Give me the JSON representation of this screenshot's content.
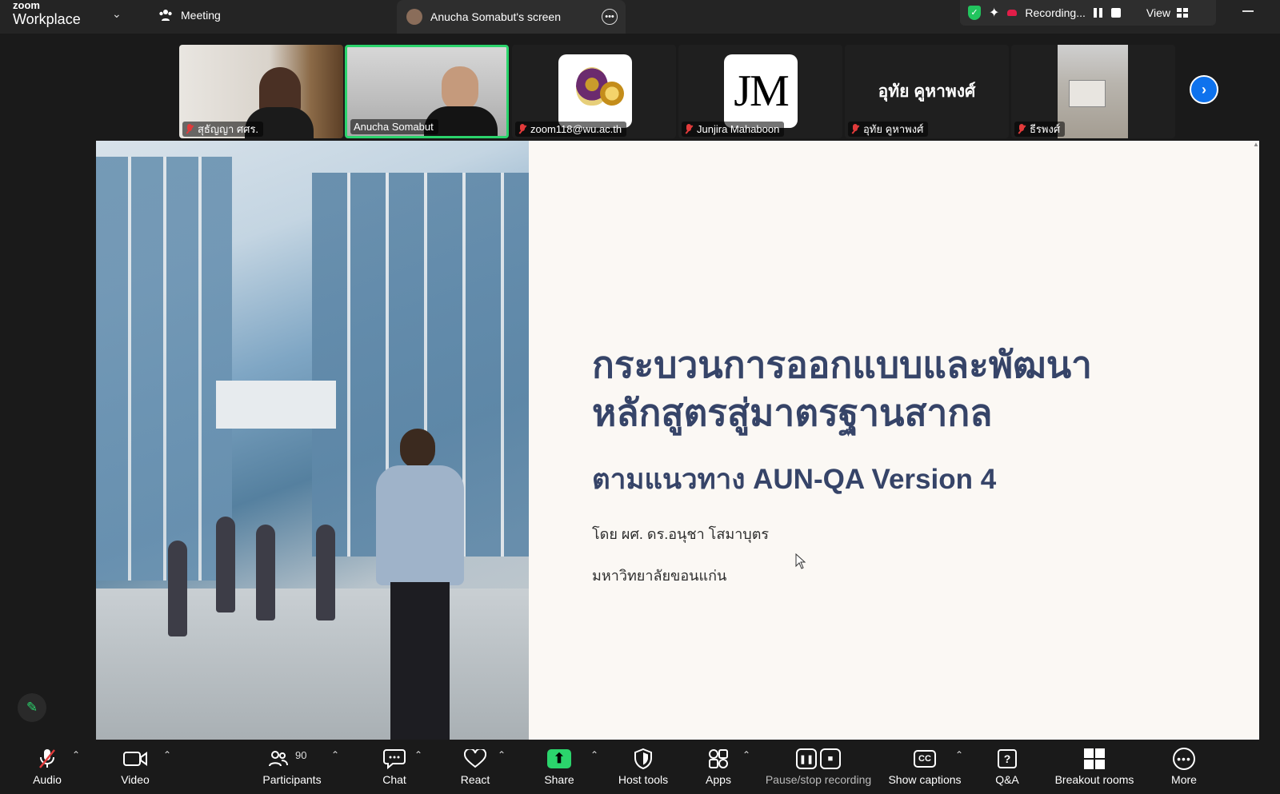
{
  "app": {
    "brand_top": "zoom",
    "brand_bottom": "Workplace"
  },
  "topbar": {
    "meeting_label": "Meeting",
    "screen_tab_label": "Anucha Somabut's screen",
    "recording_label": "Recording...",
    "view_label": "View"
  },
  "gallery": [
    {
      "name": "สุธัญญา ศศร.",
      "muted": true
    },
    {
      "name": "Anucha Somabut",
      "muted": false,
      "active": true
    },
    {
      "name": "zoom118@wu.ac.th",
      "muted": true
    },
    {
      "name": "Junjira Mahaboon",
      "muted": true
    },
    {
      "name": "อุทัย คูหาพงศ์",
      "muted": true
    },
    {
      "name": "ธีรพงศ์",
      "muted": true
    }
  ],
  "gallery_center_name": "อุทัย คูหาพงศ์",
  "jm_logo_text": "JM",
  "slide": {
    "title_line1": "กระบวนการออกแบบและพัฒนา",
    "title_line2": "หลักสูตรสู่มาตรฐานสากล",
    "subtitle": "ตามแนวทาง AUN-QA Version 4",
    "author": "โดย ผศ. ดร.อนุชา โสมาบุตร",
    "affiliation": "มหาวิทยาลัยขอนแก่น"
  },
  "toolbar": {
    "audio": "Audio",
    "video": "Video",
    "participants": "Participants",
    "participants_count": "90",
    "chat": "Chat",
    "react": "React",
    "share": "Share",
    "host_tools": "Host tools",
    "apps": "Apps",
    "pause_stop": "Pause/stop recording",
    "captions": "Show captions",
    "qa": "Q&A",
    "breakout": "Breakout rooms",
    "more": "More"
  },
  "colors": {
    "accent_green": "#2bd46c",
    "title_navy": "#364468",
    "next_blue": "#0e72ed",
    "mute_red": "#e23b3b"
  }
}
